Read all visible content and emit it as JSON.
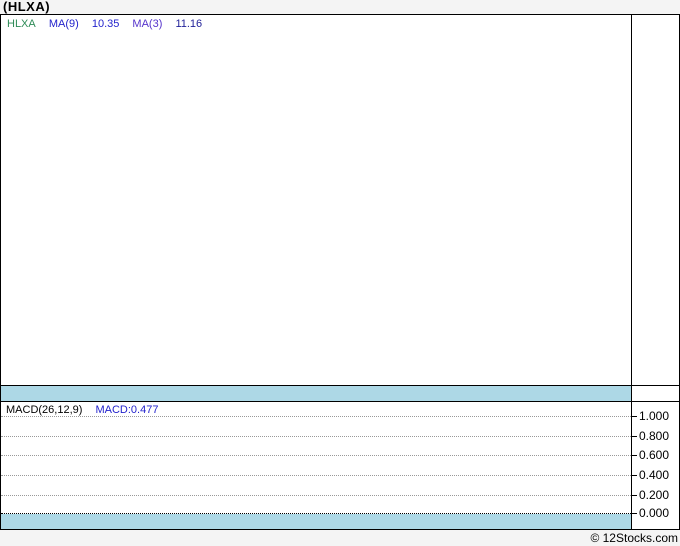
{
  "page": {
    "title": "(HLXA)",
    "footer": "© 12Stocks.com"
  },
  "main_chart": {
    "legend": {
      "symbol": "HLXA",
      "ma9_label": "MA(9)",
      "ma9_value": "10.35",
      "ma3_label": "MA(3)",
      "ma3_value": "11.16"
    }
  },
  "macd_panel": {
    "legend_label": "MACD(26,12,9)",
    "legend_value": "MACD:0.477",
    "axis_ticks": [
      "1.000",
      "0.800",
      "0.600",
      "0.400",
      "0.200",
      "0.000"
    ]
  },
  "colors": {
    "page_bg": "#f4f4f4",
    "panel_bg": "#ffffff",
    "border": "#000000",
    "band_cyan": "#add8e6",
    "grid_gray": "#999999",
    "legend_green": "#2e8b57",
    "legend_blue": "#2222cc",
    "legend_purple": "#5533cc",
    "legend_navy": "#222299",
    "text": "#000000"
  },
  "chart_data": [
    {
      "type": "line",
      "title": "(HLXA)",
      "series": [
        {
          "name": "HLXA",
          "values": []
        },
        {
          "name": "MA(9)",
          "last_value": 10.35,
          "values": []
        },
        {
          "name": "MA(3)",
          "last_value": 11.16,
          "values": []
        }
      ],
      "annotations": [
        "HLXA",
        "MA(9)",
        "10.35",
        "MA(3)",
        "11.16"
      ],
      "grid": false,
      "note": "price panel is empty - no series plotted in the visible area"
    },
    {
      "type": "line",
      "title": "MACD(26,12,9)",
      "series": [
        {
          "name": "MACD",
          "last_value": 0.477,
          "values": []
        }
      ],
      "ylabel": "",
      "ylim": [
        -0.15,
        1.1
      ],
      "yticks": [
        1.0,
        0.8,
        0.6,
        0.4,
        0.2,
        0.0
      ],
      "grid": true,
      "legend_position": "top-left",
      "note": "region below 0.000 is shaded light blue; no MACD curve visible"
    }
  ]
}
